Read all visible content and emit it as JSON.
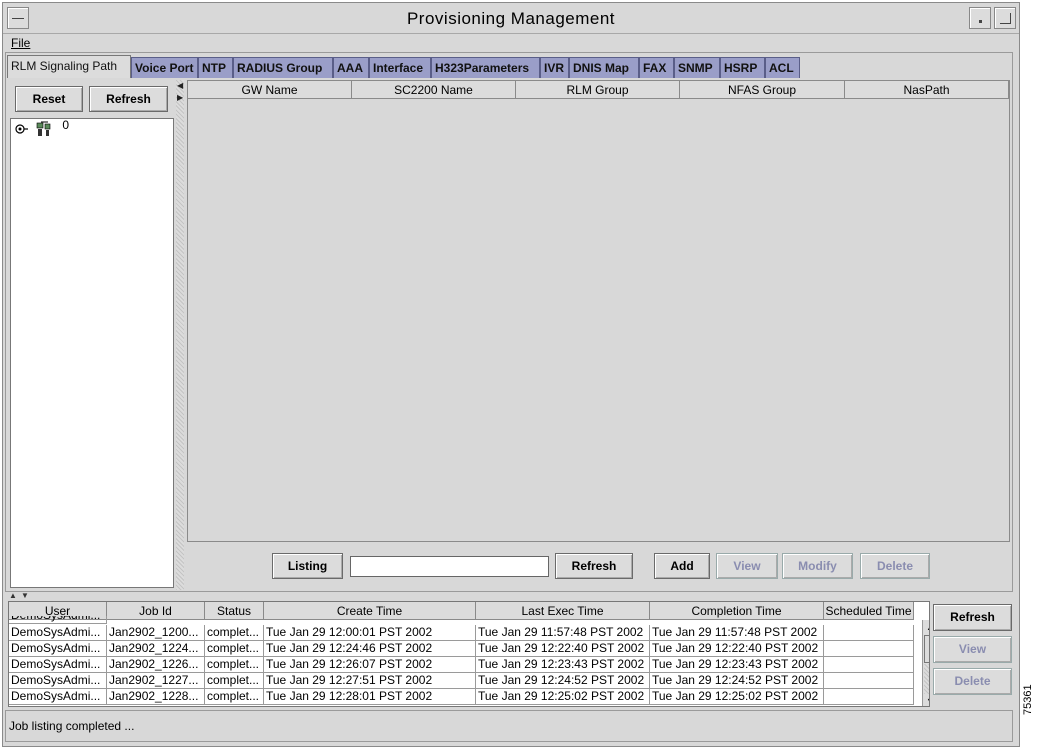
{
  "window": {
    "title": "Provisioning Management"
  },
  "menu": {
    "file_label": "File"
  },
  "tabs": [
    "RLM Signaling Path",
    "Voice Port",
    "NTP",
    "RADIUS Group",
    "AAA",
    "Interface",
    "H323Parameters",
    "IVR",
    "DNIS Map",
    "FAX",
    "SNMP",
    "HSRP",
    "ACL"
  ],
  "left_pane": {
    "reset_label": "Reset",
    "refresh_label": "Refresh",
    "tree_root_label": "0"
  },
  "signaling_table": {
    "columns": [
      "GW Name",
      "SC2200 Name",
      "RLM Group",
      "NFAS Group",
      "NasPath"
    ]
  },
  "actions": {
    "listing_label": "Listing",
    "search_value": "",
    "refresh_label": "Refresh",
    "add_label": "Add",
    "view_label": "View",
    "modify_label": "Modify",
    "delete_label": "Delete"
  },
  "jobs": {
    "columns": [
      "User",
      "Job Id",
      "Status",
      "Create Time",
      "Last Exec Time",
      "Completion Time",
      "Scheduled Time"
    ],
    "rows": [
      [
        "DemoSysAdmi...",
        "Jan2902_1200...",
        "complet...",
        "Tue Jan 29 12:00:01 PST 2002",
        "Tue Jan 29 11:57:48 PST 2002",
        "Tue Jan 29 11:57:48 PST 2002",
        ""
      ],
      [
        "DemoSysAdmi...",
        "Jan2902_1224...",
        "complet...",
        "Tue Jan 29 12:24:46 PST 2002",
        "Tue Jan 29 12:22:40 PST 2002",
        "Tue Jan 29 12:22:40 PST 2002",
        ""
      ],
      [
        "DemoSysAdmi...",
        "Jan2902_1226...",
        "complet...",
        "Tue Jan 29 12:26:07 PST 2002",
        "Tue Jan 29 12:23:43 PST 2002",
        "Tue Jan 29 12:23:43 PST 2002",
        ""
      ],
      [
        "DemoSysAdmi...",
        "Jan2902_1227...",
        "complet...",
        "Tue Jan 29 12:27:51 PST 2002",
        "Tue Jan 29 12:24:52 PST 2002",
        "Tue Jan 29 12:24:52 PST 2002",
        ""
      ],
      [
        "DemoSysAdmi...",
        "Jan2902_1228...",
        "complet...",
        "Tue Jan 29 12:28:01 PST 2002",
        "Tue Jan 29 12:25:02 PST 2002",
        "Tue Jan 29 12:25:02 PST 2002",
        ""
      ]
    ],
    "refresh_label": "Refresh",
    "view_label": "View",
    "delete_label": "Delete"
  },
  "status": {
    "text": "Job listing completed ..."
  },
  "figure_number": "75361"
}
